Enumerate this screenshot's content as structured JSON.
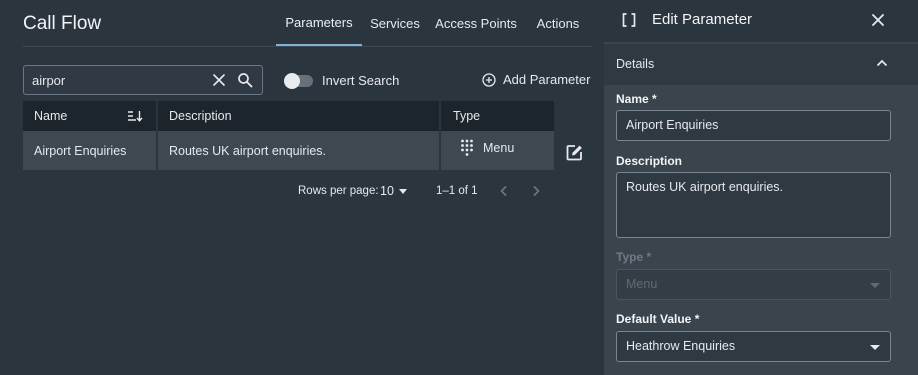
{
  "main": {
    "title": "Call Flow",
    "tabs": [
      {
        "label": "Parameters",
        "active": true
      },
      {
        "label": "Services",
        "active": false
      },
      {
        "label": "Access Points",
        "active": false
      },
      {
        "label": "Actions",
        "active": false
      }
    ],
    "search": {
      "value": "airpor",
      "placeholder": ""
    },
    "invert_search_label": "Invert Search",
    "invert_search_on": false,
    "add_parameter_label": "Add Parameter",
    "table": {
      "columns": [
        "Name",
        "Description",
        "Type"
      ],
      "rows": [
        {
          "name": "Airport Enquiries",
          "description": "Routes UK airport enquiries.",
          "type": "Menu",
          "type_icon": "keypad-icon"
        }
      ]
    },
    "pagination": {
      "rows_per_page_label": "Rows per page:",
      "rows_per_page_value": "10",
      "range": "1–1 of 1"
    }
  },
  "panel": {
    "title": "Edit Parameter",
    "section_title": "Details",
    "name_label": "Name *",
    "name_value": "Airport Enquiries",
    "description_label": "Description",
    "description_value": "Routes UK airport enquiries.",
    "type_label": "Type *",
    "type_value": "Menu",
    "default_value_label": "Default Value *",
    "default_value_value": "Heathrow Enquiries"
  },
  "colors": {
    "background": "#2b353e",
    "panel": "#3a444d",
    "header_row": "#1c252c",
    "selected_row": "#3e4851",
    "accent": "#7fb2d8"
  }
}
